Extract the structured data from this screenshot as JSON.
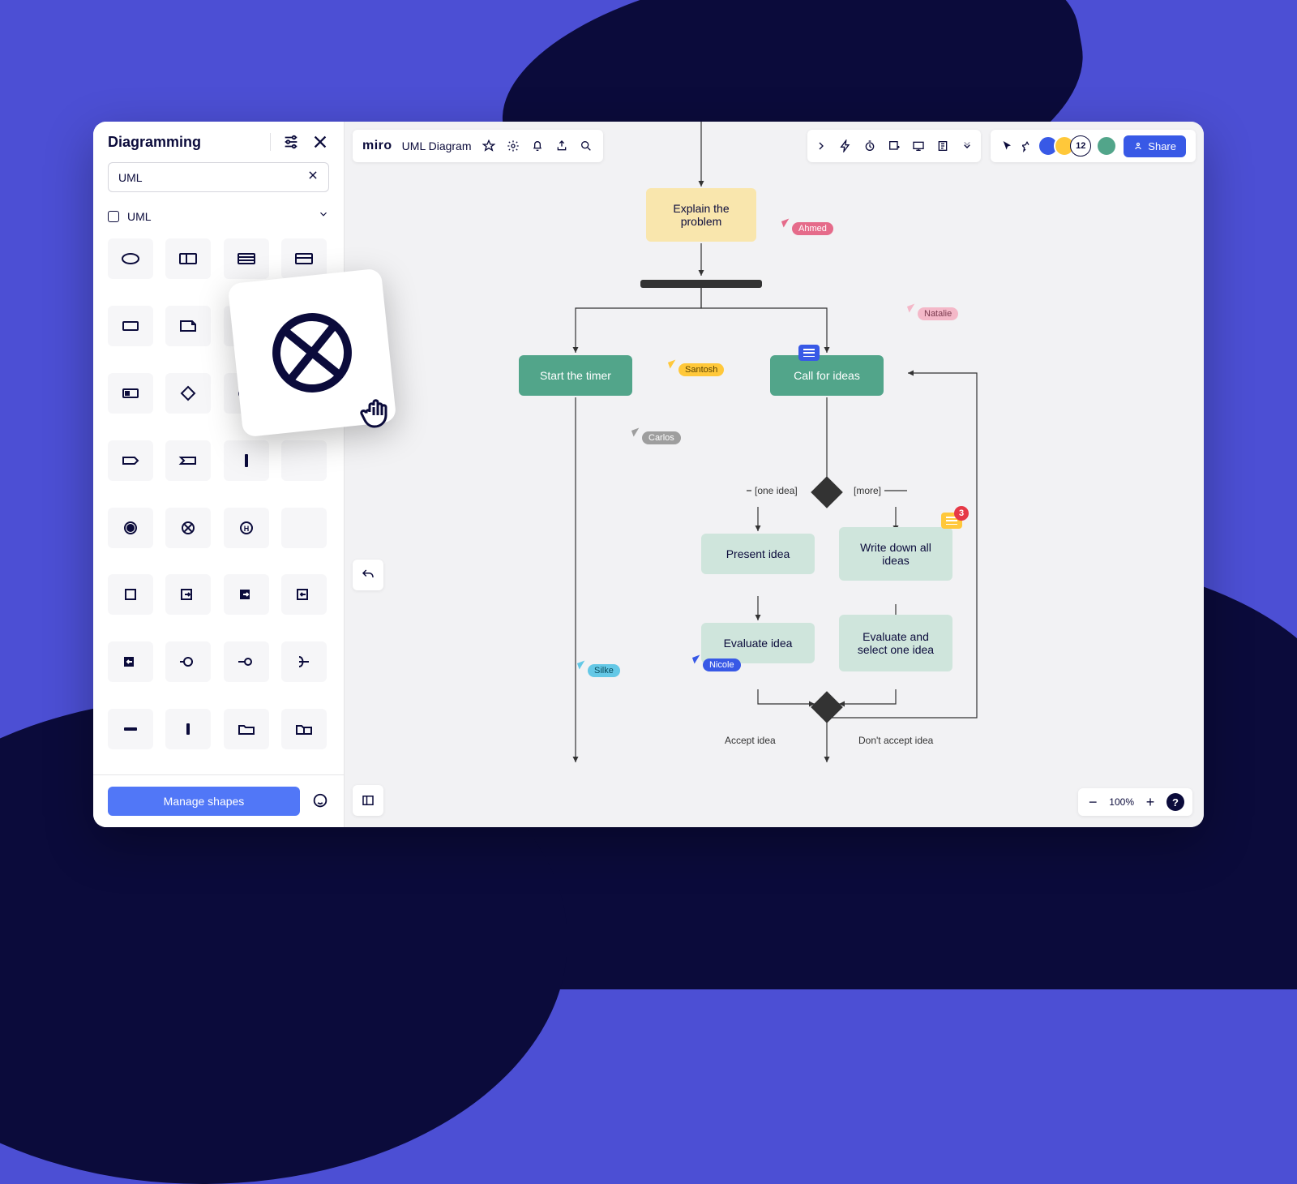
{
  "panel": {
    "title": "Diagramming",
    "search_value": "UML",
    "category_label": "UML",
    "manage_button": "Manage shapes"
  },
  "topbar": {
    "logo": "miro",
    "board_name": "UML Diagram",
    "share": "Share",
    "avatar_count": "12"
  },
  "zoom": {
    "value": "100%"
  },
  "diagram": {
    "explain": "Explain the problem",
    "start_timer": "Start the timer",
    "call_ideas": "Call for ideas",
    "present": "Present idea",
    "evaluate": "Evaluate idea",
    "write_all": "Write down all ideas",
    "eval_select": "Evaluate and select one idea",
    "branch_one": "[one idea]",
    "branch_more": "[more]",
    "accept": "Accept idea",
    "dont_accept": "Don't accept idea",
    "comment_badge": "3"
  },
  "cursors": {
    "ahmed": "Ahmed",
    "natalie": "Natalie",
    "santosh": "Santosh",
    "carlos": "Carlos",
    "nicole": "Nicole",
    "silke": "Silke"
  },
  "colors": {
    "ahmed": "#e56b8a",
    "natalie": "#f4b8c8",
    "santosh": "#ffc83a",
    "carlos": "#9e9e9e",
    "nicole": "#3859e6",
    "silke": "#64c8e6"
  }
}
